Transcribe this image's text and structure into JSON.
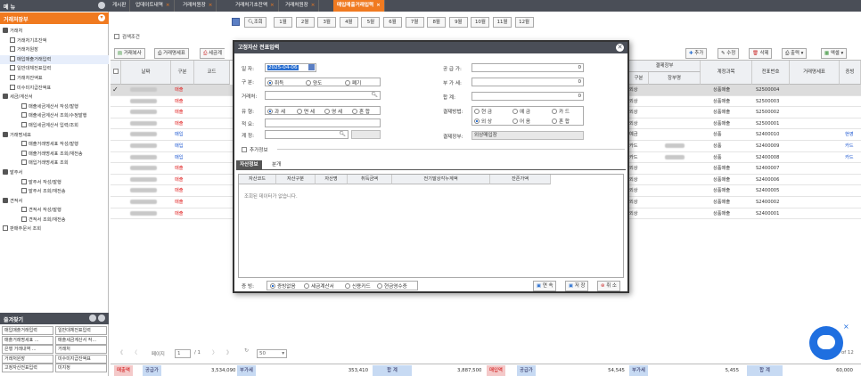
{
  "sidebar": {
    "title": "메 뉴",
    "category": "거래처장부",
    "tree": [
      {
        "label": "거래처",
        "level": 0,
        "type": "folder"
      },
      {
        "label": "거래처기초잔액",
        "level": 1,
        "type": "file"
      },
      {
        "label": "거래처원장",
        "level": 1,
        "type": "file"
      },
      {
        "label": "매입매출거래입력",
        "level": 1,
        "type": "file"
      },
      {
        "label": "일반대체전표입력",
        "level": 1,
        "type": "file"
      },
      {
        "label": "거래처잔액표",
        "level": 1,
        "type": "file"
      },
      {
        "label": "미수미지급잔액표",
        "level": 1,
        "type": "file"
      },
      {
        "label": "세금/계산서",
        "level": 0,
        "type": "folder"
      },
      {
        "label": "매출세금계산서 작성/발행",
        "level": 2,
        "type": "file"
      },
      {
        "label": "매출세금계산서 조회/수정발행",
        "level": 2,
        "type": "file"
      },
      {
        "label": "매입세금계산서 입력/조회",
        "level": 2,
        "type": "file"
      },
      {
        "label": "거래명세표",
        "level": 0,
        "type": "folder"
      },
      {
        "label": "매출거래명세표 작성/발행",
        "level": 2,
        "type": "file"
      },
      {
        "label": "매출거래명세표 조회/재전송",
        "level": 2,
        "type": "file"
      },
      {
        "label": "매입거래명세표 조회",
        "level": 2,
        "type": "file"
      },
      {
        "label": "발주서",
        "level": 0,
        "type": "folder"
      },
      {
        "label": "발주서 작성/발행",
        "level": 2,
        "type": "file"
      },
      {
        "label": "발주서 조회/재전송",
        "level": 2,
        "type": "file"
      },
      {
        "label": "견적서",
        "level": 0,
        "type": "folder"
      },
      {
        "label": "견적서 작성/발행",
        "level": 2,
        "type": "file"
      },
      {
        "label": "견적서 조회/재전송",
        "level": 2,
        "type": "file"
      },
      {
        "label": "판매주문서 조회",
        "level": 0,
        "type": "file"
      }
    ],
    "favorites_title": "즐겨찾기",
    "favorites": [
      "매입매출거래입력",
      "일반대체전표입력",
      "매출거래명세표 ...",
      "매출세금계산서 작...",
      "은행 거래내역 ...",
      "거래처",
      "거래처원장",
      "미수미지급잔액표",
      "고정자산전표입력",
      "미지정"
    ]
  },
  "tabs": [
    "게시판",
    "업데이트내역",
    "거래처원장",
    "거래처기초잔액",
    "거래처원장",
    "매입매출거래입력"
  ],
  "active_tab": "매입매출거래입력",
  "toolbar": {
    "search": "조회",
    "months": [
      "1월",
      "2월",
      "3월",
      "4월",
      "5월",
      "6월",
      "7월",
      "8월",
      "9월",
      "10월",
      "11월",
      "12월"
    ],
    "condition": "검색조건",
    "copy": "거래복사",
    "stmt": "거래명세표",
    "tax": "세금계",
    "add": "추가",
    "edit": "수정",
    "delete": "삭제",
    "print": "출력",
    "excel": "엑셀"
  },
  "grid": {
    "headers": {
      "date": "날짜",
      "type": "구분",
      "code": "코드",
      "settle_group": "결제장부",
      "settle_type": "구분",
      "settle_book": "장부명",
      "account": "계정과목",
      "slip": "전표번호",
      "stmt": "거래명세표",
      "proof": "증빙"
    },
    "rows": [
      {
        "type": "매출",
        "settle": "외상",
        "account": "상품매출",
        "slip": "S2500004",
        "proof": "",
        "selected": true,
        "checked": true
      },
      {
        "type": "매출",
        "settle": "외상",
        "account": "상품매출",
        "slip": "S2500003",
        "proof": ""
      },
      {
        "type": "매출",
        "settle": "외상",
        "account": "상품매출",
        "slip": "S2500002",
        "proof": ""
      },
      {
        "type": "매출",
        "settle": "외상",
        "account": "상품매출",
        "slip": "S2500001",
        "proof": ""
      },
      {
        "type": "매입",
        "settle": "예금",
        "account": "상품",
        "slip": "S2400010",
        "proof": "현영"
      },
      {
        "type": "매입",
        "settle": "카드",
        "account": "상품",
        "slip": "S2400009",
        "proof": "카드"
      },
      {
        "type": "매입",
        "settle": "카드",
        "account": "상품",
        "slip": "S2400008",
        "proof": "카드"
      },
      {
        "type": "매출",
        "settle": "외상",
        "account": "상품매출",
        "slip": "S2400007",
        "proof": ""
      },
      {
        "type": "매출",
        "settle": "외상",
        "account": "상품매출",
        "slip": "S2400006",
        "proof": ""
      },
      {
        "type": "매출",
        "settle": "외상",
        "account": "상품매출",
        "slip": "S2400005",
        "proof": ""
      },
      {
        "type": "매출",
        "settle": "외상",
        "account": "상품매출",
        "slip": "S2400002",
        "proof": ""
      },
      {
        "type": "매출",
        "settle": "외상",
        "account": "상품매출",
        "slip": "S2400001",
        "proof": ""
      }
    ]
  },
  "pager": {
    "page_label": "페이지",
    "page": "1",
    "total": "/ 1",
    "page_size": "50",
    "of": "of 12"
  },
  "footer": {
    "sales_label": "매출액",
    "supply_label": "공급가",
    "supply_sales": "3,534,090",
    "vat_label": "부가세",
    "vat_sales": "353,410",
    "total_label": "합 계",
    "total_sales": "3,887,500",
    "purchase_label": "매입액",
    "supply_purchase": "54,545",
    "vat_purchase": "5,455",
    "total_purchase": "60,000"
  },
  "modal": {
    "title": "고정자산 전표입력",
    "date_label": "일 자:",
    "date_value": "2025-04-06",
    "category_label": "구 분:",
    "category_opts": [
      "취득",
      "양도",
      "폐기"
    ],
    "vendor_label": "거래처:",
    "kind_label": "유 형:",
    "kind_opts": [
      "과 세",
      "면 세",
      "영 세",
      "혼 합"
    ],
    "summary_label": "적 요:",
    "account_label": "계 정:",
    "supply_label": "공 급 가:",
    "supply_value": "0",
    "vat_label": "부 가 세:",
    "vat_value": "0",
    "sum_label": "합 계:",
    "sum_value": "0",
    "pay_label": "결제방법:",
    "pay_opts": [
      "현 금",
      "예 금",
      "카 드",
      "외 상",
      "어 음",
      "혼 합"
    ],
    "book_label": "결제장부:",
    "book_value": "외상매입장",
    "extra": "추가정보",
    "tabs": [
      "자산정보",
      "분개"
    ],
    "grid_headers": [
      "자산코드",
      "자산구분",
      "자산명",
      "취득금액",
      "전기말상각누계액",
      "잔존가액"
    ],
    "empty": "조회된 데이터가 없습니다.",
    "proof_label": "증 빙:",
    "proof_opts": [
      "증빙없음",
      "세금계산서",
      "신용카드",
      "현금영수증"
    ],
    "btn_continue": "연 속",
    "btn_save": "저 장",
    "btn_cancel": "취 소"
  }
}
